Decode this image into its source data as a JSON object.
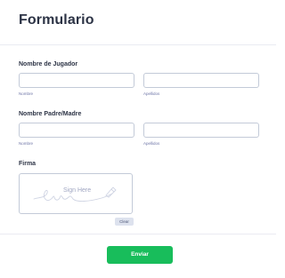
{
  "form": {
    "title": "Formulario",
    "player": {
      "label": "Nombre de Jugador",
      "first_sublabel": "Nombre",
      "last_sublabel": "Apellidos",
      "first_value": "",
      "last_value": ""
    },
    "parent": {
      "label": "Nombre Padre/Madre",
      "first_sublabel": "Nombre",
      "last_sublabel": "Apellidos",
      "first_value": "",
      "last_value": ""
    },
    "signature": {
      "label": "Firma",
      "placeholder": "Sign Here",
      "clear_label": "Clear"
    },
    "submit_label": "Enviar"
  },
  "colors": {
    "accent": "#18bd5b",
    "text": "#2c3345",
    "border": "#c3cad8",
    "muted": "#6f76a7"
  }
}
